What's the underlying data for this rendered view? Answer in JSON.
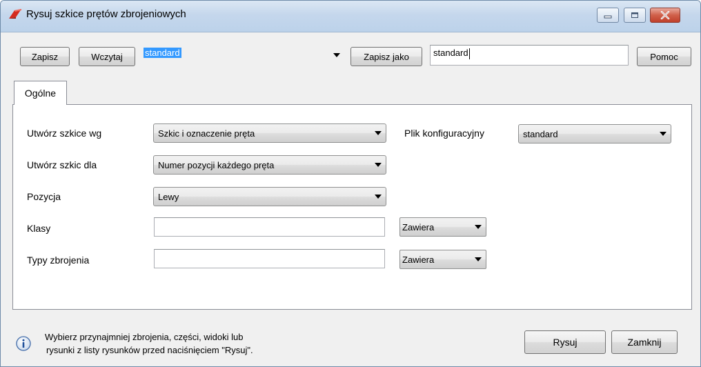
{
  "window": {
    "title": "Rysuj szkice prętów zbrojeniowych",
    "accent": "#c03f2a"
  },
  "toolbar": {
    "save_label": "Zapisz",
    "load_label": "Wczytaj",
    "preset_value": "standard",
    "save_as_label": "Zapisz jako",
    "save_as_value": "standard",
    "help_label": "Pomoc"
  },
  "tabs": [
    {
      "label": "Ogólne",
      "selected": true
    }
  ],
  "form": {
    "create_by_label": "Utwórz szkice wg",
    "create_by_value": "Szkic i oznaczenie pręta",
    "create_for_label": "Utwórz szkic dla",
    "create_for_value": "Numer pozycji każdego pręta",
    "position_label": "Pozycja",
    "position_value": "Lewy",
    "classes_label": "Klasy",
    "classes_value": "",
    "classes_filter": "Zawiera",
    "types_label": "Typy zbrojenia",
    "types_value": "",
    "types_filter": "Zawiera",
    "config_label": "Plik konfiguracyjny",
    "config_value": "standard"
  },
  "footer": {
    "info_line1": "Wybierz przynajmniej zbrojenia, części, widoki lub",
    "info_line2": "rysunki z listy rysunków przed naciśnięciem \"Rysuj\".",
    "draw_label": "Rysuj",
    "close_label": "Zamknij"
  }
}
